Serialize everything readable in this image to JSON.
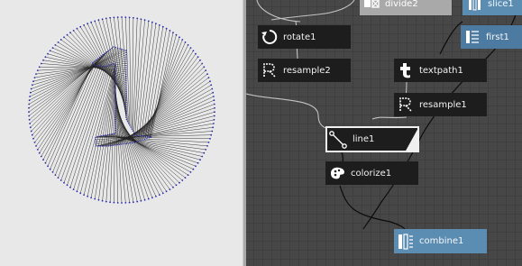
{
  "nodes": {
    "divide2": {
      "label": "divide2",
      "icon": "divide-icon"
    },
    "slice1": {
      "label": "slice1",
      "icon": "slice-icon"
    },
    "first1": {
      "label": "first1",
      "icon": "first-icon"
    },
    "rotate1": {
      "label": "rotate1",
      "icon": "rotate-icon"
    },
    "resample2": {
      "label": "resample2",
      "icon": "resample-icon"
    },
    "textpath1": {
      "label": "textpath1",
      "icon": "text-icon"
    },
    "resample1": {
      "label": "resample1",
      "icon": "resample-icon"
    },
    "line1": {
      "label": "line1",
      "icon": "line-icon"
    },
    "colorize1": {
      "label": "colorize1",
      "icon": "colorize-icon"
    },
    "combine1": {
      "label": "combine1",
      "icon": "combine-icon"
    }
  },
  "colors": {
    "viewer_bg": "#e8e8e8",
    "network_bg": "#474747",
    "node_dark": "#1d1d1d",
    "node_blue": "#5b8db3",
    "point_color": "#2a2aa8",
    "line_color": "#000000"
  }
}
